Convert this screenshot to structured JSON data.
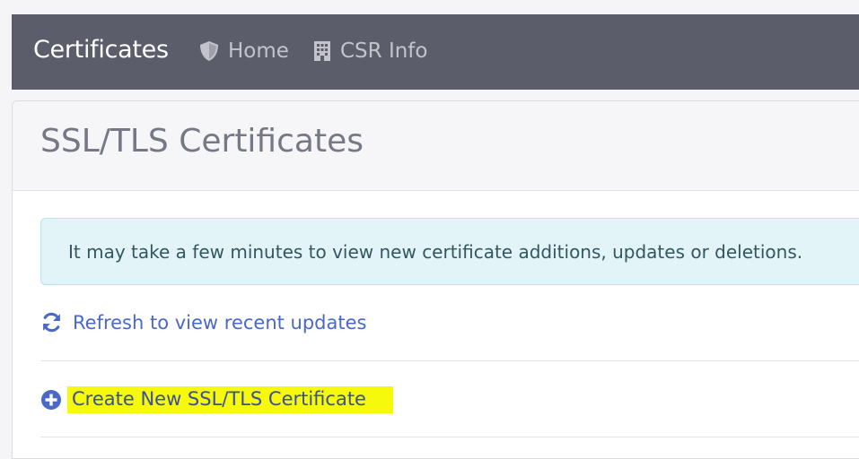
{
  "navbar": {
    "brand": "Certificates",
    "links": [
      {
        "label": "Home",
        "icon": "shield-icon"
      },
      {
        "label": "CSR Info",
        "icon": "building-icon"
      }
    ]
  },
  "card": {
    "title": "SSL/TLS Certificates",
    "alert_text": "It may take a few minutes to view new certificate additions, updates or deletions.",
    "refresh_label": "Refresh to view recent updates",
    "create_label": "Create New SSL/TLS Certificate"
  },
  "colors": {
    "navbar_bg": "#5b5d6b",
    "link": "#4a68c8",
    "alert_bg": "#e2f4f8",
    "highlight": "#f7f90a"
  }
}
